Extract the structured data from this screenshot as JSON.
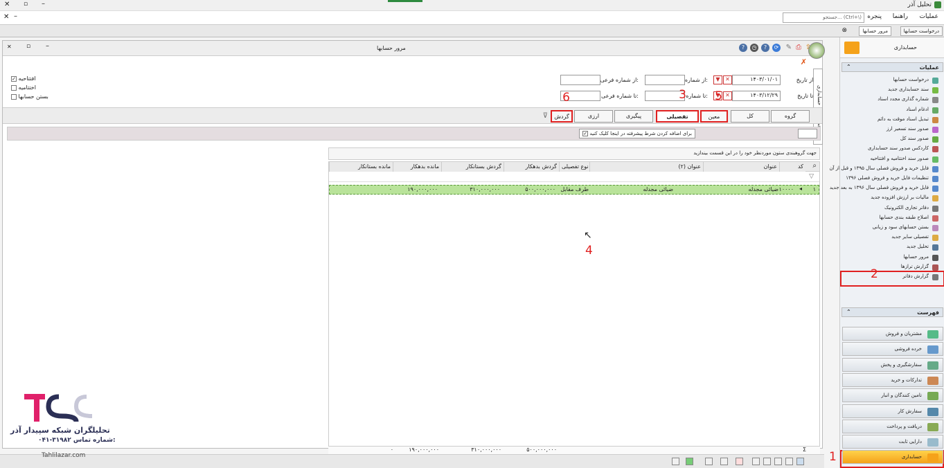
{
  "app": {
    "title": "تحلیل آذر"
  },
  "menubar": {
    "items": [
      "عملیات",
      "راهنما",
      "پنجره"
    ],
    "search_placeholder": "جستجو... (Ctrl+\\)"
  },
  "doc_tabs": [
    "درخواست حسابها",
    "مرور حسابها",
    "درخواست حسابها"
  ],
  "window": {
    "title": "مرور حسابها"
  },
  "side_tab": "خصوصیات حسابداری",
  "filters": {
    "from_date_label": "از تاریخ:",
    "from_date": "۱۴۰۳/۰۱/۰۱",
    "to_date_label": "تا تاریخ:",
    "to_date": "۱۴۰۳/۱۲/۲۹",
    "from_num_label": "از شماره:",
    "to_num_label": "تا شماره:",
    "from_sub_label": "از شماره فرعی:",
    "to_sub_label": "تا شماره فرعی:",
    "cb_opening": "افتتاحیه",
    "cb_closing": "اختتامیه",
    "cb_close_accounts": "بستن حسابها"
  },
  "level_tabs": [
    "گروه",
    "کل",
    "معین",
    "تفصیلی",
    "پیگیری",
    "ارزی",
    "گردش"
  ],
  "adv_filter": "برای اضافه کردن شرط پیشرفته در اینجا کلیک کنید",
  "group_hint": "جهت گروهبندی ستون موردنظر خود را در این قسمت بیندازید",
  "grid": {
    "columns": [
      "کد",
      "عنوان",
      "عنوان (۲)",
      "نوع تفصیلی",
      "گردش بدهکار",
      "گردش بستانکار",
      "مانده بدهکار",
      "مانده بستانکار"
    ],
    "rows": [
      {
        "row_no": "۱",
        "code": "۱۰۰۰۰",
        "title": "ضیائی مجدله",
        "title2": "ضیائی مجدله",
        "type": "طرف مقابل",
        "debit": "۵۰۰,۰۰۰,۰۰۰",
        "credit": "۳۱۰,۰۰۰,۰۰۰",
        "bal_debit": "۱۹۰,۰۰۰,۰۰۰",
        "bal_credit": "۰"
      }
    ],
    "totals": {
      "debit": "۵۰۰,۰۰۰,۰۰۰",
      "credit": "۳۱۰,۰۰۰,۰۰۰",
      "bal_debit": "۱۹۰,۰۰۰,۰۰۰",
      "bal_credit": "۰"
    }
  },
  "right_pane": {
    "header": "حسابداری",
    "section_ops": "عملیات",
    "ops": [
      "درخواست حسابها",
      "سند حسابداری جدید",
      "شماره گذاری مجدد اسناد",
      "ادغام اسناد",
      "تبدیل اسناد موقت به دائم",
      "صدور سند تسعیر ارز",
      "صدور سند کل",
      "کاردکس صدور سند حسابداری",
      "صدور سند اختتامیه و افتتاحیه",
      "فایل خرید و فروش فصلی سال ۱۳۹۵ و قبل از آن",
      "تنظیمات فایل خرید و فروش فصلی ۱۳۹۶",
      "فایل خرید و فروش فصلی سال ۱۳۹۶ به بعد جدید",
      "مالیات بر ارزش افزوده جدید",
      "دفاتر تجاری الکترونیک",
      "اصلاح طبقه بندی حسابها",
      "بستن حسابهای سود و زیانی",
      "تفصیلی سایر جدید",
      "تحلیل جدید",
      "مرور حسابها",
      "گزارش ترازها",
      "گزارش دفاتر"
    ],
    "section_list": "فهرست",
    "modules": [
      "مشتریان و فروش",
      "خرده فروشی",
      "سفارشگیری و پخش",
      "تدارکات و خرید",
      "تامین کنندگان و انبار",
      "سفارش کار",
      "دریافت و پرداخت",
      "دارایی ثابت",
      "حسابداری"
    ]
  },
  "annotations": [
    "1",
    "2",
    "3",
    "4",
    "5",
    "6"
  ],
  "logo": {
    "line1": "تحلیلگران شبکه سپیدار آذر",
    "phone_label": "شماره تماس:",
    "phone": "۰۴۱-۳۱۹۸۲",
    "site": "Tahlilazar.com"
  },
  "colors": {
    "accent_green": "#b9e39a",
    "annotation_red": "#e02020",
    "active_module": "#f5a21a"
  }
}
